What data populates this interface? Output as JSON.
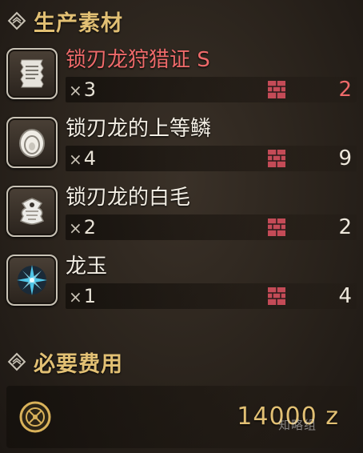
{
  "materials_section": {
    "title": "生产素材",
    "icon": "diamond-chain-icon"
  },
  "materials": [
    {
      "name": "锁刃龙狩猎证 S",
      "quantity_prefix": "×",
      "quantity": "3",
      "owned": "2",
      "highlight": true,
      "icon": "hunting-certificate-icon"
    },
    {
      "name": "锁刃龙的上等鳞",
      "quantity_prefix": "×",
      "quantity": "4",
      "owned": "9",
      "highlight": false,
      "icon": "scale-icon"
    },
    {
      "name": "锁刃龙的白毛",
      "quantity_prefix": "×",
      "quantity": "2",
      "owned": "2",
      "highlight": false,
      "icon": "fur-icon"
    },
    {
      "name": "龙玉",
      "quantity_prefix": "×",
      "quantity": "1",
      "owned": "4",
      "highlight": false,
      "icon": "dragon-gem-icon"
    }
  ],
  "cost_section": {
    "title": "必要费用",
    "icon": "diamond-chain-icon",
    "value": "14000 z",
    "currency_icon": "zenny-coin-icon"
  },
  "watermark": "知略组",
  "colors": {
    "accent_gold": "#e2c074",
    "warn_red": "#ee6a6a",
    "box_red": "#c44b57"
  }
}
